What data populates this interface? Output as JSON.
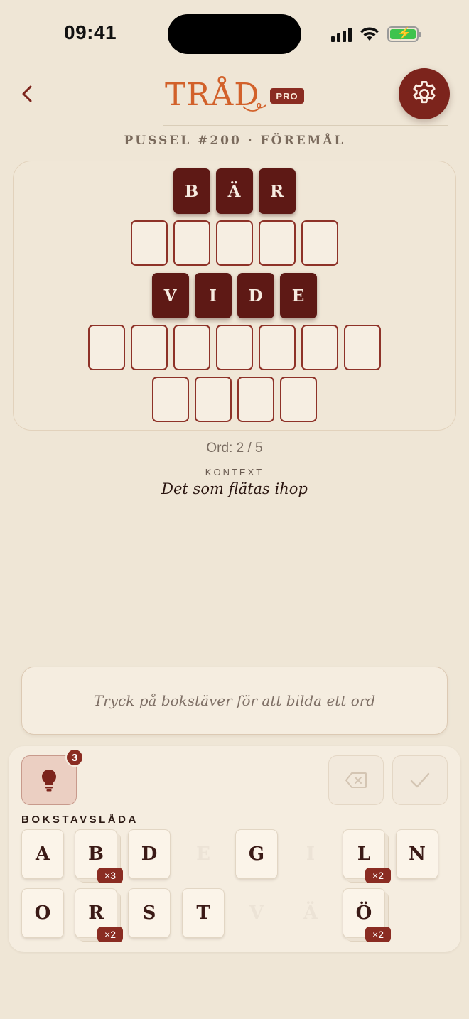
{
  "status": {
    "time": "09:41"
  },
  "header": {
    "logo": "TRÅD",
    "badge": "PRO"
  },
  "puzzle": {
    "subtitle": "PUSSEL #200 · FÖREMÅL"
  },
  "board": {
    "rows": [
      [
        "B",
        "Ä",
        "R"
      ],
      [
        "",
        "",
        "",
        "",
        ""
      ],
      [
        "V",
        "I",
        "D",
        "E"
      ],
      [
        "",
        "",
        "",
        "",
        "",
        "",
        ""
      ],
      [
        "",
        "",
        "",
        ""
      ]
    ]
  },
  "progress": {
    "label": "Ord: 2 / 5"
  },
  "context": {
    "label": "KONTEXT",
    "text": "Det som flätas ihop"
  },
  "input": {
    "placeholder": "Tryck på bokstäver för att bilda ett ord"
  },
  "tray": {
    "hint_count": "3",
    "label": "BOKSTAVSLÅDA",
    "keys": [
      {
        "letter": "A",
        "count": ""
      },
      {
        "letter": "B",
        "count": "×3"
      },
      {
        "letter": "D",
        "count": ""
      },
      {
        "letter": "E",
        "count": "",
        "used": true
      },
      {
        "letter": "G",
        "count": ""
      },
      {
        "letter": "I",
        "count": "",
        "used": true
      },
      {
        "letter": "L",
        "count": "×2"
      },
      {
        "letter": "N",
        "count": ""
      },
      {
        "letter": "O",
        "count": ""
      },
      {
        "letter": "R",
        "count": "×2"
      },
      {
        "letter": "S",
        "count": ""
      },
      {
        "letter": "T",
        "count": ""
      },
      {
        "letter": "V",
        "count": "",
        "used": true
      },
      {
        "letter": "Ä",
        "count": "",
        "used": true
      },
      {
        "letter": "Ö",
        "count": "×2"
      }
    ]
  },
  "colors": {
    "accent": "#7c241c",
    "tile_filled": "#5e1915",
    "logo": "#d2612a",
    "background": "#efe6d6"
  },
  "icons": {
    "back": "chevron-left-icon",
    "settings": "gear-icon",
    "hint": "lightbulb-icon",
    "delete": "backspace-icon",
    "submit": "checkmark-icon"
  }
}
